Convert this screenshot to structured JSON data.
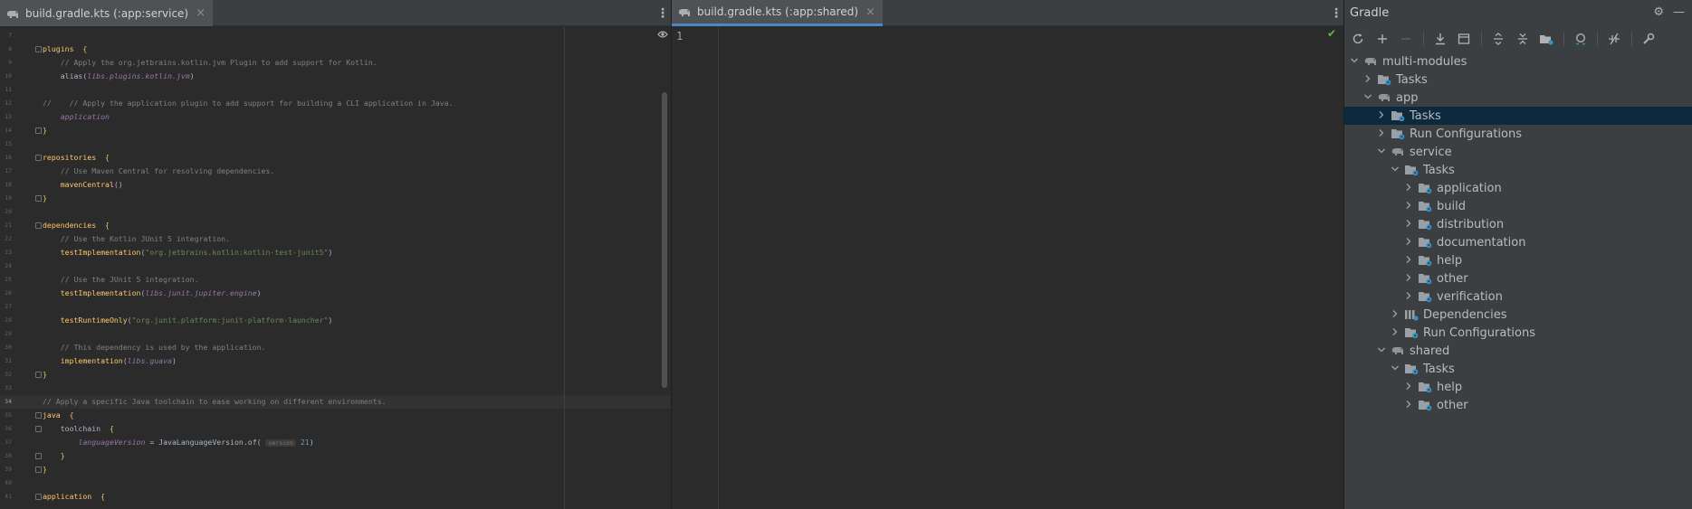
{
  "left_tab": {
    "label": "build.gradle.kts (:app:service)",
    "close": "×"
  },
  "mid_tab": {
    "label": "build.gradle.kts (:app:shared)",
    "close": "×"
  },
  "more_icon": "⋮",
  "gradle": {
    "title": "Gradle",
    "settings_icon": "⚙",
    "minimize_icon": "—",
    "toolbar": [
      "reload-icon",
      "add-icon",
      "remove-icon",
      "download-icon",
      "execute-task-icon",
      "expand-all-icon",
      "collapse-all-icon",
      "group-modules-icon",
      "analyze-icon",
      "toggle-offline-icon",
      "settings-wrench-icon"
    ],
    "tree": [
      {
        "label": "multi-modules",
        "depth": 0,
        "chev": "v",
        "icon": "elephant"
      },
      {
        "label": "Tasks",
        "depth": 1,
        "chev": ">",
        "icon": "folder"
      },
      {
        "label": "app",
        "depth": 1,
        "chev": "v",
        "icon": "elephant"
      },
      {
        "label": "Tasks",
        "depth": 2,
        "chev": ">",
        "icon": "folder",
        "selected": true
      },
      {
        "label": "Run Configurations",
        "depth": 2,
        "chev": ">",
        "icon": "folder"
      },
      {
        "label": "service",
        "depth": 2,
        "chev": "v",
        "icon": "elephant"
      },
      {
        "label": "Tasks",
        "depth": 3,
        "chev": "v",
        "icon": "folder"
      },
      {
        "label": "application",
        "depth": 4,
        "chev": ">",
        "icon": "folder"
      },
      {
        "label": "build",
        "depth": 4,
        "chev": ">",
        "icon": "folder"
      },
      {
        "label": "distribution",
        "depth": 4,
        "chev": ">",
        "icon": "folder"
      },
      {
        "label": "documentation",
        "depth": 4,
        "chev": ">",
        "icon": "folder"
      },
      {
        "label": "help",
        "depth": 4,
        "chev": ">",
        "icon": "folder"
      },
      {
        "label": "other",
        "depth": 4,
        "chev": ">",
        "icon": "folder"
      },
      {
        "label": "verification",
        "depth": 4,
        "chev": ">",
        "icon": "folder"
      },
      {
        "label": "Dependencies",
        "depth": 3,
        "chev": ">",
        "icon": "deps"
      },
      {
        "label": "Run Configurations",
        "depth": 3,
        "chev": ">",
        "icon": "folder"
      },
      {
        "label": "shared",
        "depth": 2,
        "chev": "v",
        "icon": "elephant"
      },
      {
        "label": "Tasks",
        "depth": 3,
        "chev": "v",
        "icon": "folder"
      },
      {
        "label": "help",
        "depth": 4,
        "chev": ">",
        "icon": "folder"
      },
      {
        "label": "other",
        "depth": 4,
        "chev": ">",
        "icon": "folder"
      }
    ]
  },
  "mid_editor": {
    "line_number": "1"
  },
  "code_lines": [
    {
      "n": "7",
      "t": []
    },
    {
      "n": "8",
      "fold": true,
      "t": [
        [
          "fn",
          "plugins"
        ],
        [
          "",
          "  "
        ],
        [
          "brc",
          "{"
        ]
      ]
    },
    {
      "n": "9",
      "t": [
        [
          "",
          "    "
        ],
        [
          "cmt",
          "// Apply the org.jetbrains.kotlin.jvm Plugin to add support for Kotlin."
        ]
      ]
    },
    {
      "n": "10",
      "t": [
        [
          "",
          "    alias("
        ],
        [
          "ext",
          "libs.plugins.kotlin.jvm"
        ],
        [
          "",
          ")"
        ]
      ]
    },
    {
      "n": "11",
      "t": []
    },
    {
      "n": "12",
      "t": [
        [
          "cmt",
          "//    // Apply the application plugin to add support for building a CLI application in Java."
        ]
      ]
    },
    {
      "n": "13",
      "t": [
        [
          "",
          "    "
        ],
        [
          "ext",
          "application"
        ]
      ]
    },
    {
      "n": "14",
      "fold": true,
      "t": [
        [
          "brc",
          "}"
        ]
      ]
    },
    {
      "n": "15",
      "t": []
    },
    {
      "n": "16",
      "fold": true,
      "t": [
        [
          "fn",
          "repositories"
        ],
        [
          "",
          "  "
        ],
        [
          "brc",
          "{"
        ]
      ]
    },
    {
      "n": "17",
      "t": [
        [
          "",
          "    "
        ],
        [
          "cmt",
          "// Use Maven Central for resolving dependencies."
        ]
      ]
    },
    {
      "n": "18",
      "t": [
        [
          "",
          "    "
        ],
        [
          "fn",
          "mavenCentral"
        ],
        [
          "",
          "()"
        ]
      ]
    },
    {
      "n": "19",
      "fold": true,
      "t": [
        [
          "brc",
          "}"
        ]
      ]
    },
    {
      "n": "20",
      "t": []
    },
    {
      "n": "21",
      "fold": true,
      "t": [
        [
          "fn",
          "dependencies"
        ],
        [
          "",
          "  "
        ],
        [
          "brc",
          "{"
        ]
      ]
    },
    {
      "n": "22",
      "t": [
        [
          "",
          "    "
        ],
        [
          "cmt",
          "// Use the Kotlin JUnit 5 integration."
        ]
      ]
    },
    {
      "n": "23",
      "t": [
        [
          "",
          "    "
        ],
        [
          "fn",
          "testImplementation"
        ],
        [
          "",
          "("
        ],
        [
          "str",
          "\"org.jetbrains.kotlin:kotlin-test-junit5\""
        ],
        [
          "",
          ")"
        ]
      ]
    },
    {
      "n": "24",
      "t": []
    },
    {
      "n": "25",
      "t": [
        [
          "",
          "    "
        ],
        [
          "cmt",
          "// Use the JUnit 5 integration."
        ]
      ]
    },
    {
      "n": "26",
      "t": [
        [
          "",
          "    "
        ],
        [
          "fn",
          "testImplementation"
        ],
        [
          "",
          "("
        ],
        [
          "ext",
          "libs.junit.jupiter.engine"
        ],
        [
          "",
          ")"
        ]
      ]
    },
    {
      "n": "27",
      "t": []
    },
    {
      "n": "28",
      "t": [
        [
          "",
          "    "
        ],
        [
          "fn",
          "testRuntimeOnly"
        ],
        [
          "",
          "("
        ],
        [
          "str",
          "\"org.junit.platform:junit-platform-launcher\""
        ],
        [
          "",
          ")"
        ]
      ]
    },
    {
      "n": "29",
      "t": []
    },
    {
      "n": "30",
      "t": [
        [
          "",
          "    "
        ],
        [
          "cmt",
          "// This dependency is used by the application."
        ]
      ]
    },
    {
      "n": "31",
      "t": [
        [
          "",
          "    "
        ],
        [
          "fn",
          "implementation"
        ],
        [
          "",
          "("
        ],
        [
          "ext",
          "libs.guava"
        ],
        [
          "",
          ")"
        ]
      ]
    },
    {
      "n": "32",
      "fold": true,
      "t": [
        [
          "brc",
          "}"
        ]
      ]
    },
    {
      "n": "33",
      "t": []
    },
    {
      "n": "34",
      "current": true,
      "t": [
        [
          "cmt",
          "// Apply a specific Java toolchain to ease working on different environments."
        ]
      ]
    },
    {
      "n": "35",
      "fold": true,
      "t": [
        [
          "fn",
          "java"
        ],
        [
          "",
          "  "
        ],
        [
          "brc",
          "{"
        ]
      ]
    },
    {
      "n": "36",
      "fold": true,
      "t": [
        [
          "",
          "    toolchain  "
        ],
        [
          "brc",
          "{"
        ]
      ]
    },
    {
      "n": "37",
      "t": [
        [
          "",
          "        "
        ],
        [
          "ext",
          "languageVersion"
        ],
        [
          "",
          " = JavaLanguageVersion.of( "
        ],
        [
          "hint",
          "version"
        ],
        [
          "num",
          " 21"
        ],
        [
          "",
          ")"
        ]
      ]
    },
    {
      "n": "38",
      "fold": true,
      "t": [
        [
          "",
          "    "
        ],
        [
          "brc",
          "}"
        ]
      ]
    },
    {
      "n": "39",
      "fold": true,
      "t": [
        [
          "brc",
          "}"
        ]
      ]
    },
    {
      "n": "40",
      "t": []
    },
    {
      "n": "41",
      "fold": true,
      "t": [
        [
          "fn",
          "application"
        ],
        [
          "",
          "  "
        ],
        [
          "brc",
          "{"
        ]
      ]
    }
  ]
}
